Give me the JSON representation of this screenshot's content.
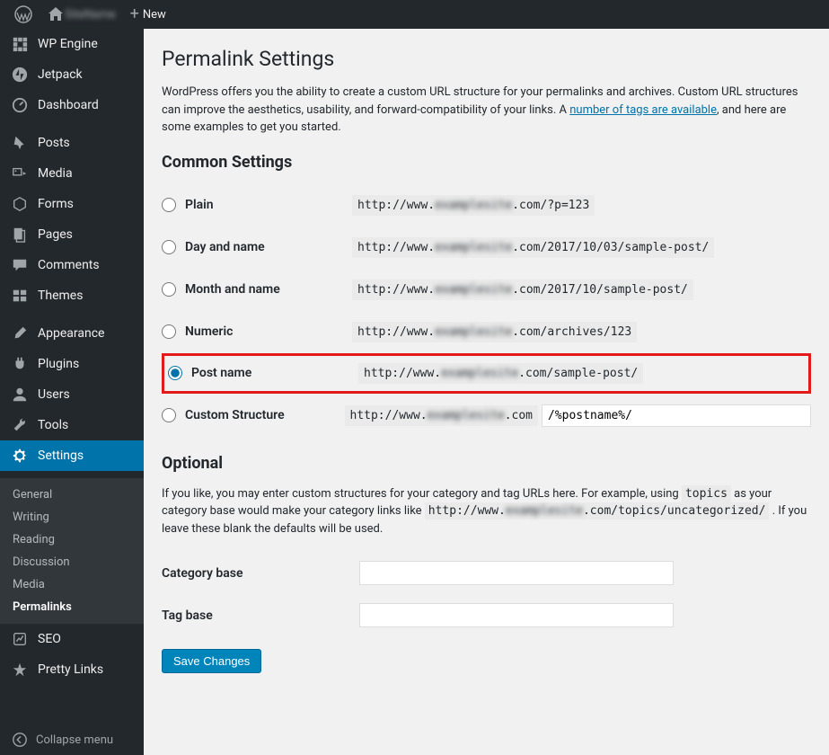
{
  "adminbar": {
    "site_name": "SiteName",
    "new_label": "New"
  },
  "sidebar": {
    "items": [
      {
        "label": "WP Engine",
        "icon": "wpengine"
      },
      {
        "label": "Jetpack",
        "icon": "jetpack"
      },
      {
        "label": "Dashboard",
        "icon": "dashboard"
      },
      {
        "label": "Posts",
        "icon": "pin"
      },
      {
        "label": "Media",
        "icon": "media"
      },
      {
        "label": "Forms",
        "icon": "forms"
      },
      {
        "label": "Pages",
        "icon": "page"
      },
      {
        "label": "Comments",
        "icon": "comment"
      },
      {
        "label": "Themes",
        "icon": "themes"
      },
      {
        "label": "Appearance",
        "icon": "brush"
      },
      {
        "label": "Plugins",
        "icon": "plug"
      },
      {
        "label": "Users",
        "icon": "user"
      },
      {
        "label": "Tools",
        "icon": "wrench"
      },
      {
        "label": "Settings",
        "icon": "gear"
      },
      {
        "label": "SEO",
        "icon": "seo"
      },
      {
        "label": "Pretty Links",
        "icon": "star"
      }
    ],
    "submenu": [
      "General",
      "Writing",
      "Reading",
      "Discussion",
      "Media",
      "Permalinks"
    ],
    "collapse": "Collapse menu"
  },
  "page": {
    "title": "Permalink Settings",
    "intro_pre": "WordPress offers you the ability to create a custom URL structure for your permalinks and archives. Custom URL structures can improve the aesthetics, usability, and forward-compatibility of your links. A ",
    "intro_link": "number of tags are available",
    "intro_post": ", and here are some examples to get you started.",
    "common_heading": "Common Settings",
    "domain_mask": "examplesite",
    "options": [
      {
        "key": "plain",
        "label": "Plain",
        "pre": "http://www.",
        "post": ".com/?p=123"
      },
      {
        "key": "day",
        "label": "Day and name",
        "pre": "http://www.",
        "post": ".com/2017/10/03/sample-post/"
      },
      {
        "key": "month",
        "label": "Month and name",
        "pre": "http://www.",
        "post": ".com/2017/10/sample-post/"
      },
      {
        "key": "numeric",
        "label": "Numeric",
        "pre": "http://www.",
        "post": ".com/archives/123"
      },
      {
        "key": "postname",
        "label": "Post name",
        "pre": "http://www.",
        "post": ".com/sample-post/"
      }
    ],
    "custom": {
      "label": "Custom Structure",
      "pre": "http://www.",
      "post": ".com",
      "value": "/%postname%/"
    },
    "optional_heading": "Optional",
    "optional_desc_pre": "If you like, you may enter custom structures for your category and tag URLs here. For example, using ",
    "optional_code1": "topics",
    "optional_desc_mid": " as your category base would make your category links like ",
    "optional_code2_pre": "http://www.",
    "optional_code2_post": ".com/topics/uncategorized/",
    "optional_desc_post": " . If you leave these blank the defaults will be used.",
    "category_label": "Category base",
    "tag_label": "Tag base",
    "save_label": "Save Changes"
  }
}
